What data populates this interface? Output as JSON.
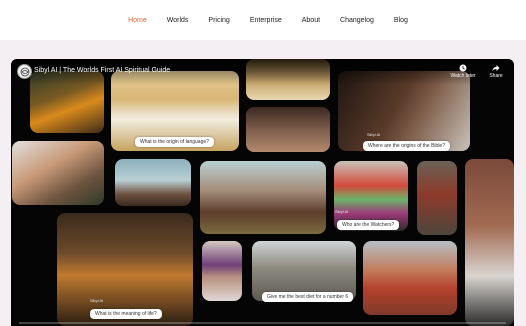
{
  "nav": {
    "items": [
      {
        "label": "Home",
        "active": true
      },
      {
        "label": "Worlds",
        "active": false
      },
      {
        "label": "Pricing",
        "active": false
      },
      {
        "label": "Enterprise",
        "active": false
      },
      {
        "label": "About",
        "active": false
      },
      {
        "label": "Changelog",
        "active": false
      },
      {
        "label": "Blog",
        "active": false
      }
    ],
    "active_color": "#e46a36"
  },
  "video": {
    "title": "Sibyl AI | The Worlds First AI Spiritual Guide",
    "watch_later_label": "Watch later",
    "share_label": "Share",
    "icons": [
      "channel-logo",
      "clock-icon",
      "share-icon"
    ],
    "captions": {
      "language": "What is the origin of language?",
      "bible": "Where are the origins of the Bible?",
      "watchers": "Who are the Watchers?",
      "meaning": "What is the meaning of life?",
      "diet": "Give me the best diet for a number 6"
    },
    "tags": {
      "sibyl_1": "Sibyl AI",
      "sibyl_2": "Sibyl AI",
      "sibyl_3": "Sibyl AI"
    },
    "progress": 0
  }
}
